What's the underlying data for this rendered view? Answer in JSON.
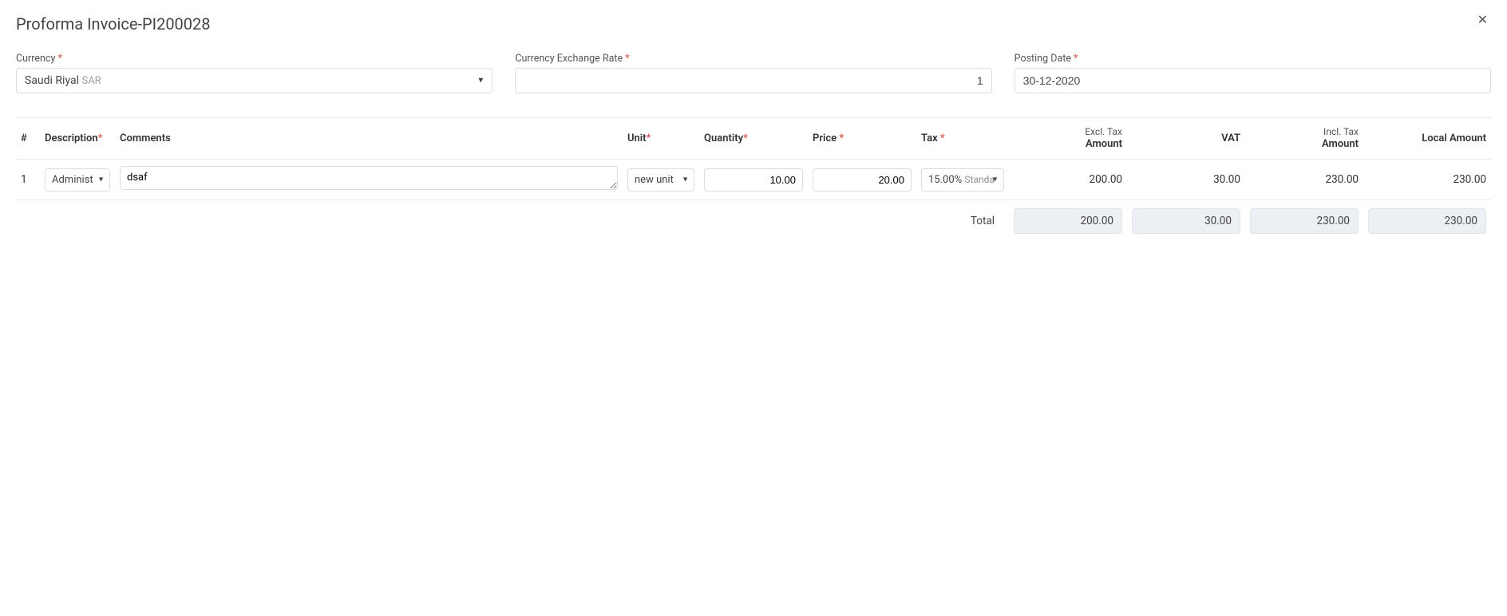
{
  "page": {
    "title": "Proforma Invoice-PI200028"
  },
  "form": {
    "currency": {
      "label": "Currency",
      "value_name": "Saudi Riyal",
      "value_code": "SAR"
    },
    "exchange_rate": {
      "label": "Currency Exchange Rate",
      "value": "1"
    },
    "posting_date": {
      "label": "Posting Date",
      "value": "30-12-2020"
    }
  },
  "grid": {
    "headers": {
      "idx": "#",
      "description": "Description",
      "comments": "Comments",
      "unit": "Unit",
      "quantity": "Quantity",
      "price": "Price",
      "tax": "Tax",
      "excl_top": "Excl. Tax",
      "excl_bottom": "Amount",
      "vat": "VAT",
      "incl_top": "Incl. Tax",
      "incl_bottom": "Amount",
      "local": "Local Amount"
    },
    "row": {
      "idx": "1",
      "description": "Administ",
      "comments": "dsaf",
      "unit": "new unit",
      "quantity": "10.00",
      "price": "20.00",
      "tax_pct": "15.00%",
      "tax_name": "Standa",
      "excl_amount": "200.00",
      "vat": "30.00",
      "incl_amount": "230.00",
      "local_amount": "230.00"
    },
    "totals": {
      "label": "Total",
      "excl_amount": "200.00",
      "vat": "30.00",
      "incl_amount": "230.00",
      "local_amount": "230.00"
    }
  }
}
